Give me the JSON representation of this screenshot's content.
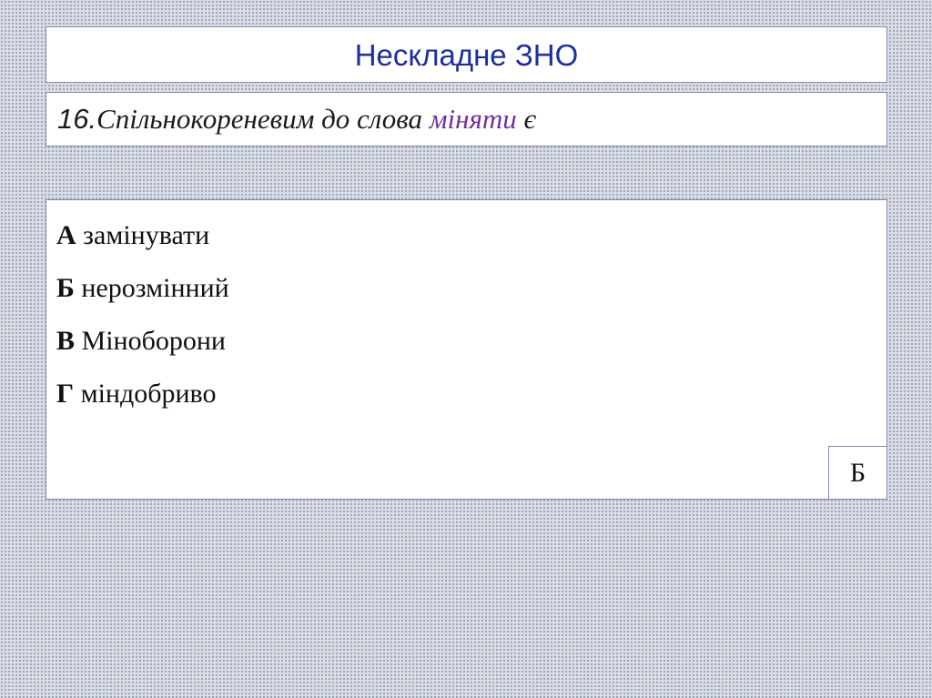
{
  "header": {
    "title": "Нескладне ЗНО"
  },
  "question": {
    "number": "16.",
    "text": "Спільнокореневим до слова ",
    "highlight_word": "міняти",
    "suffix": " є"
  },
  "options": [
    {
      "letter": "А",
      "text": " замінувати"
    },
    {
      "letter": "Б",
      "text": " нерозмінний"
    },
    {
      "letter": "В",
      "text": " Міноборони"
    },
    {
      "letter": "Г",
      "text": " міндобриво"
    }
  ],
  "answer": {
    "value": "Б"
  },
  "colors": {
    "title": "#1f2e9e",
    "highlight": "#7030a0",
    "border": "#7b8bb0"
  }
}
